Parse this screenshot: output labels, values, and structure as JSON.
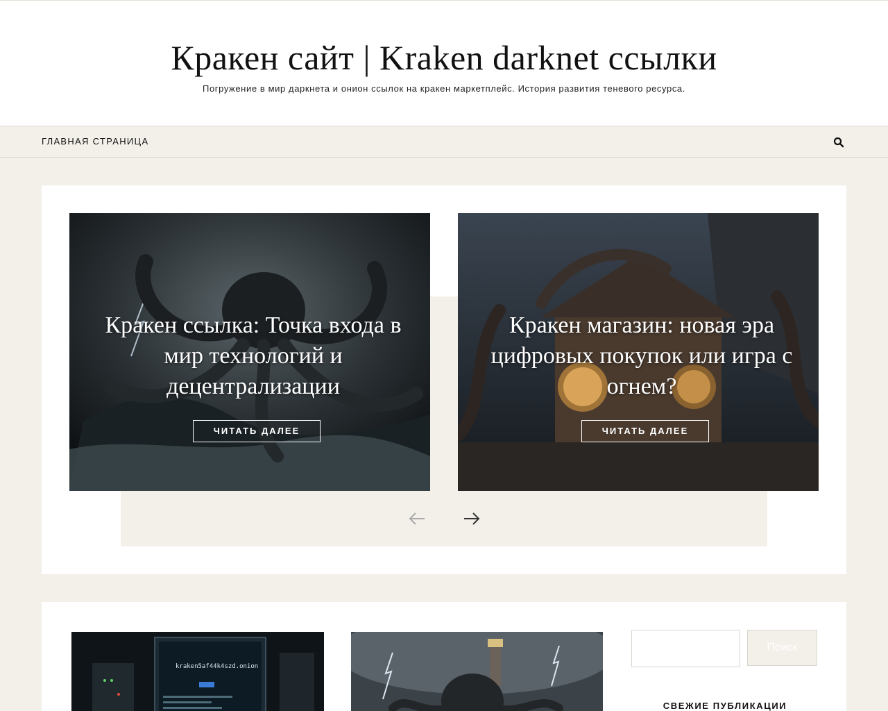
{
  "header": {
    "site_title": "Кракен сайт | Kraken darknet ссылки",
    "site_description": "Погружение в мир даркнета и онион ссылок на кракен маркетплейс. История развития теневого ресурса."
  },
  "nav": {
    "home_label": "ГЛАВНАЯ СТРАНИЦА",
    "search_icon": "search-icon"
  },
  "slider": {
    "slides": [
      {
        "title": "Кракен ссылка: Точка входа в мир технологий и децентрализации",
        "button_label": "ЧИТАТЬ ДАЛЕЕ"
      },
      {
        "title": "Кракен магазин: новая эра цифровых покупок или игра с огнем?",
        "button_label": "ЧИТАТЬ ДАЛЕЕ"
      }
    ],
    "prev_icon": "arrow-left-icon",
    "next_icon": "arrow-right-icon"
  },
  "posts": {
    "thumb_1_text": "kraken5af44k4szd.onion"
  },
  "sidebar": {
    "search_button_label": "Поиск",
    "recent_posts_title": "СВЕЖИЕ ПУБЛИКАЦИИ"
  },
  "colors": {
    "background": "#f3f0ea",
    "surface": "#ffffff",
    "text": "#111111"
  }
}
